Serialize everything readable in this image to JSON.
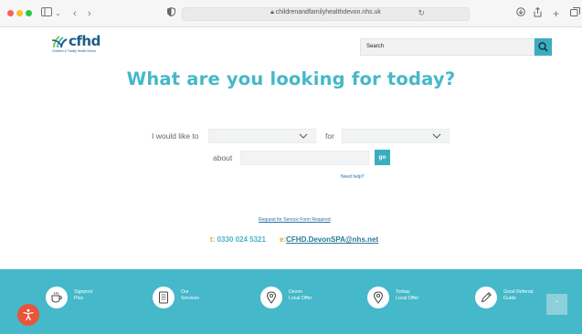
{
  "browser": {
    "url": "childrenandfamilyhealthdevon.nhs.uk"
  },
  "header": {
    "logo_text": "cfhd",
    "logo_tagline": "Children & Family Health Devon",
    "search_placeholder": "Search"
  },
  "hero": {
    "title": "What are you looking for today?"
  },
  "form": {
    "like_label": "I would like to",
    "for_label": "for",
    "about_label": "about",
    "go_label": "go",
    "help_link": "Need help?",
    "request_link": "Request for Service Form Required"
  },
  "contact": {
    "phone_key": "t:",
    "phone": "0330 024 5321",
    "email_key": "e:",
    "email": "CFHD.DevonSPA@nhs.net"
  },
  "footer": {
    "items": [
      {
        "line1": "Signpost",
        "line2": "Plus",
        "icon": "cup-icon"
      },
      {
        "line1": "Our",
        "line2": "Services",
        "icon": "document-icon"
      },
      {
        "line1": "Devon",
        "line2": "Local Offer",
        "icon": "map-pin-icon"
      },
      {
        "line1": "Torbay",
        "line2": "Local Offer",
        "icon": "map-pin-icon"
      },
      {
        "line1": "Good Referral",
        "line2": "Guide",
        "icon": "pen-icon"
      }
    ]
  },
  "colors": {
    "brand_teal": "#45b8c9",
    "brand_blue": "#1b5d8a",
    "accent_orange": "#e7a825",
    "accessibility_red": "#e8553a"
  }
}
